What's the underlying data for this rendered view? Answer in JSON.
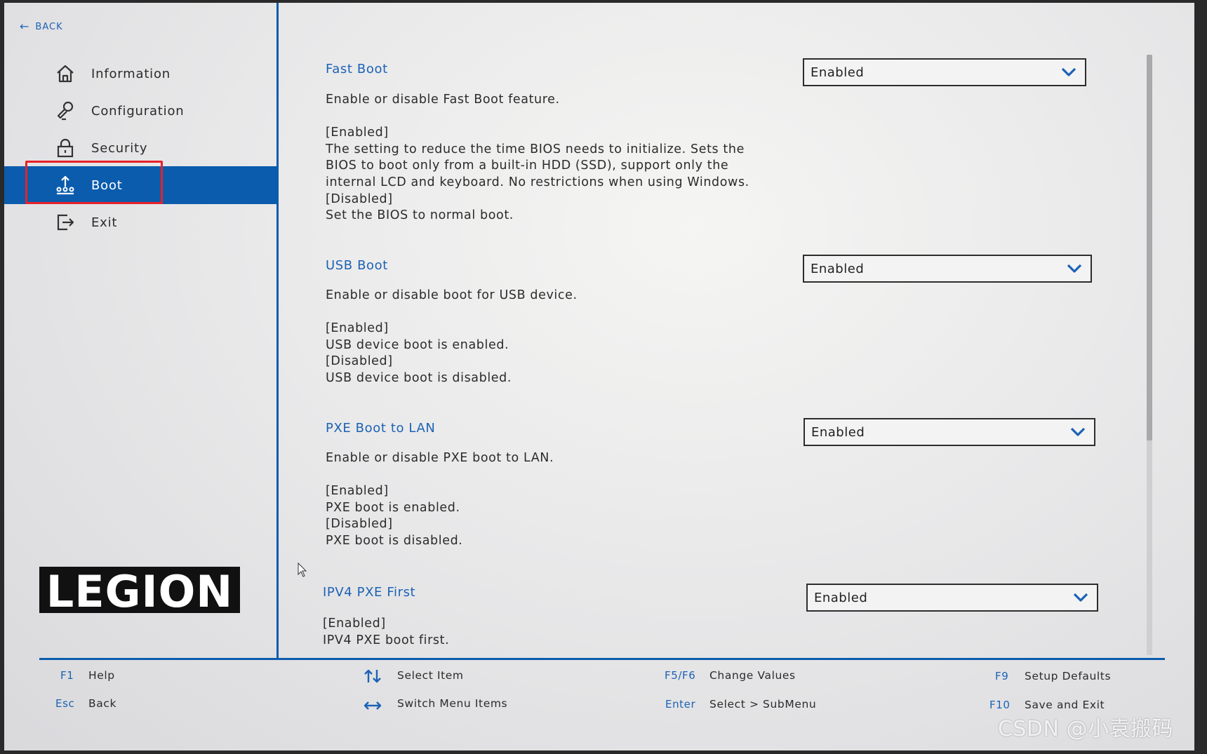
{
  "nav": {
    "back_label": "BACK",
    "items": [
      {
        "label": "Information",
        "icon": "home-icon"
      },
      {
        "label": "Configuration",
        "icon": "configuration-icon"
      },
      {
        "label": "Security",
        "icon": "lock-icon"
      },
      {
        "label": "Boot",
        "icon": "boot-icon",
        "active": true
      },
      {
        "label": "Exit",
        "icon": "exit-icon"
      }
    ]
  },
  "logo_text": "LEGION",
  "sections": [
    {
      "title": "Fast Boot",
      "description": "Enable or disable Fast Boot feature.\n\n[Enabled]\nThe setting to reduce the time BIOS needs to initialize. Sets the\nBIOS to boot only from a built-in HDD (SSD), support only the\ninternal LCD and keyboard. No restrictions when using Windows.\n[Disabled]\nSet the BIOS to normal boot.",
      "value": "Enabled"
    },
    {
      "title": "USB Boot",
      "description": "Enable or disable boot for USB device.\n\n[Enabled]\nUSB device boot is enabled.\n[Disabled]\nUSB device boot is disabled.",
      "value": "Enabled"
    },
    {
      "title": "PXE Boot to LAN",
      "description": "Enable or disable PXE boot to LAN.\n\n[Enabled]\nPXE boot is enabled.\n[Disabled]\nPXE boot is disabled.",
      "value": "Enabled"
    },
    {
      "title": "IPV4 PXE First",
      "description": "[Enabled]\nIPV4 PXE boot first.",
      "value": "Enabled"
    }
  ],
  "footer": {
    "f1_key": "F1",
    "f1_label": "Help",
    "esc_key": "Esc",
    "esc_label": "Back",
    "select_item_label": "Select Item",
    "switch_menu_label": "Switch Menu Items",
    "f5f6_key": "F5/F6",
    "f5f6_label": "Change Values",
    "enter_key": "Enter",
    "enter_label": "Select > SubMenu",
    "f9_key": "F9",
    "f9_label": "Setup Defaults",
    "f10_key": "F10",
    "f10_label": "Save and Exit"
  },
  "watermark": "CSDN @小袁搬码",
  "colors": {
    "accent": "#0b5cad",
    "link": "#1c62b5",
    "highlight_border": "#e8202a"
  }
}
